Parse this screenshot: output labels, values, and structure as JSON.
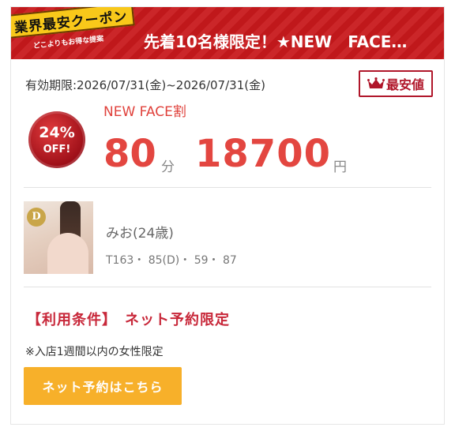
{
  "header": {
    "badge_title": "業界最安クーポン",
    "badge_sub": "どこよりもお得な提案",
    "title": "先着10名様限定！★NEW　FACE…"
  },
  "validity": "有効期限:2026/07/31(金)~2026/07/31(金)",
  "cheapest_label": "最安値",
  "discount": {
    "percent": "24%",
    "off": "OFF!"
  },
  "plan_name": "NEW FACE割",
  "duration": {
    "value": "80",
    "unit": "分"
  },
  "price": {
    "value": "18700",
    "unit": "円"
  },
  "photo_logo": "D",
  "profile": {
    "name": "みお(24歳)",
    "stats": "T163・ 85(D)・ 59・ 87"
  },
  "terms": "【利用条件】　ネット予約限定",
  "note": "※入店1週間以内の女性限定",
  "reserve_button": "ネット予約はこちら",
  "colors": {
    "accent_red": "#e34640",
    "header_red": "#c8191c",
    "button_orange": "#f7b02a"
  }
}
